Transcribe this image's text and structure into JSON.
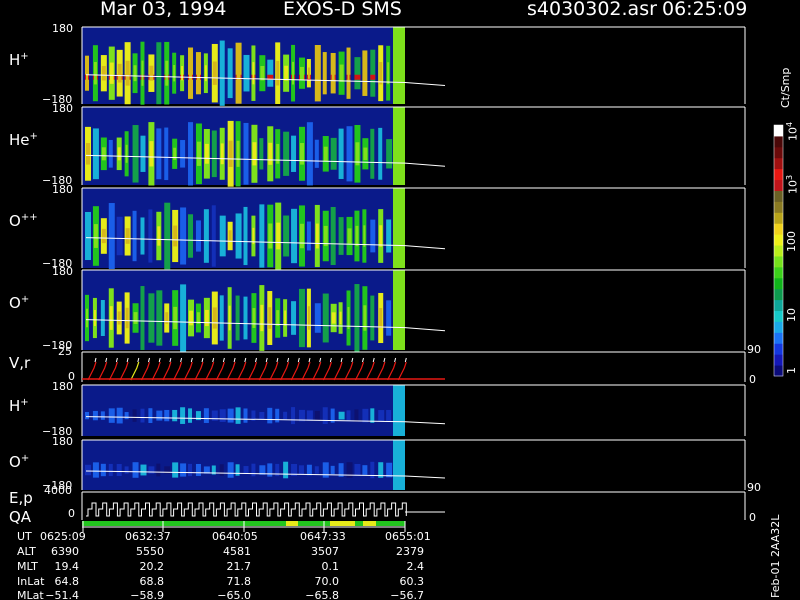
{
  "header": {
    "date": "Mar 03, 1994",
    "instrument": "EXOS-D SMS",
    "file": "s4030302.asr",
    "time": "06:25:09"
  },
  "colorbar": {
    "unit": "Ct/Smp",
    "ticks": [
      "1",
      "10",
      "100",
      "10",
      "10"
    ],
    "tick_exponents": [
      "",
      "",
      "",
      "3",
      "4"
    ],
    "colors": [
      "#0b0b7a",
      "#1418b8",
      "#1438e0",
      "#1b73f5",
      "#1aa9e8",
      "#16c9c9",
      "#0ea69a",
      "#0d9a4e",
      "#10b41a",
      "#3cd01a",
      "#76e21c",
      "#b9ee1c",
      "#eef01a",
      "#f0d21c",
      "#b8a41a",
      "#8a7a22",
      "#6a6024",
      "#c0141a",
      "#e81812",
      "#a01010",
      "#6b0a0a",
      "#4a0808",
      "#ffffff"
    ]
  },
  "panels": [
    {
      "id": "h-plus",
      "label": "H",
      "sup": "+",
      "ytop": "180",
      "ybot": "−180"
    },
    {
      "id": "he-plus",
      "label": "He",
      "sup": "+",
      "ytop": "180",
      "ybot": "−180"
    },
    {
      "id": "o-plusplus",
      "label": "O",
      "sup": "++",
      "ytop": "180",
      "ybot": "−180"
    },
    {
      "id": "o-plus",
      "label": "O",
      "sup": "+",
      "ytop": "180",
      "ybot": "−180"
    },
    {
      "id": "h-plus-2",
      "label": "H",
      "sup": "+",
      "ytop": "180",
      "ybot": "−180"
    },
    {
      "id": "o-plus-2",
      "label": "O",
      "sup": "+",
      "ytop": "180",
      "ybot": "−180"
    }
  ],
  "vr_panel": {
    "label": "V,r",
    "ytop": "25",
    "ybot": "0",
    "right_top": "90",
    "right_bot": "0"
  },
  "ep_panel": {
    "label1": "E,p",
    "label2": "QA",
    "ytop": "4000",
    "ybot": "0",
    "right_top": "90",
    "right_bot": "0"
  },
  "table": {
    "row_labels": [
      "UT",
      "ALT",
      "MLT",
      "InLat",
      "MLat"
    ],
    "columns": [
      [
        "0625:09",
        "6390",
        "19.4",
        "64.8",
        "−51.4"
      ],
      [
        "0632:37",
        "5550",
        "20.2",
        "68.8",
        "−58.9"
      ],
      [
        "0640:05",
        "4581",
        "21.7",
        "71.8",
        "−65.0"
      ],
      [
        "0647:33",
        "3507",
        "0.1",
        "70.0",
        "−65.8"
      ],
      [
        "0655:01",
        "2379",
        "2.4",
        "60.3",
        "−56.7"
      ]
    ]
  },
  "footer": {
    "version": "Feb-01 2AA32L"
  },
  "chart_data": {
    "type": "heatmap",
    "title": "Mar 03, 1994   EXOS-D SMS",
    "x_tick_labels": [
      "0625:09",
      "0632:37",
      "0640:05",
      "0647:33",
      "0655:01"
    ],
    "ylim": [
      -180,
      180
    ],
    "series": [
      {
        "name": "H+"
      },
      {
        "name": "He+"
      },
      {
        "name": "O++"
      },
      {
        "name": "O+"
      },
      {
        "name": "H+"
      },
      {
        "name": "O+"
      }
    ],
    "colorbar": {
      "unit": "Ct/Smp",
      "range": [
        1,
        10000
      ],
      "scale": "log"
    }
  }
}
